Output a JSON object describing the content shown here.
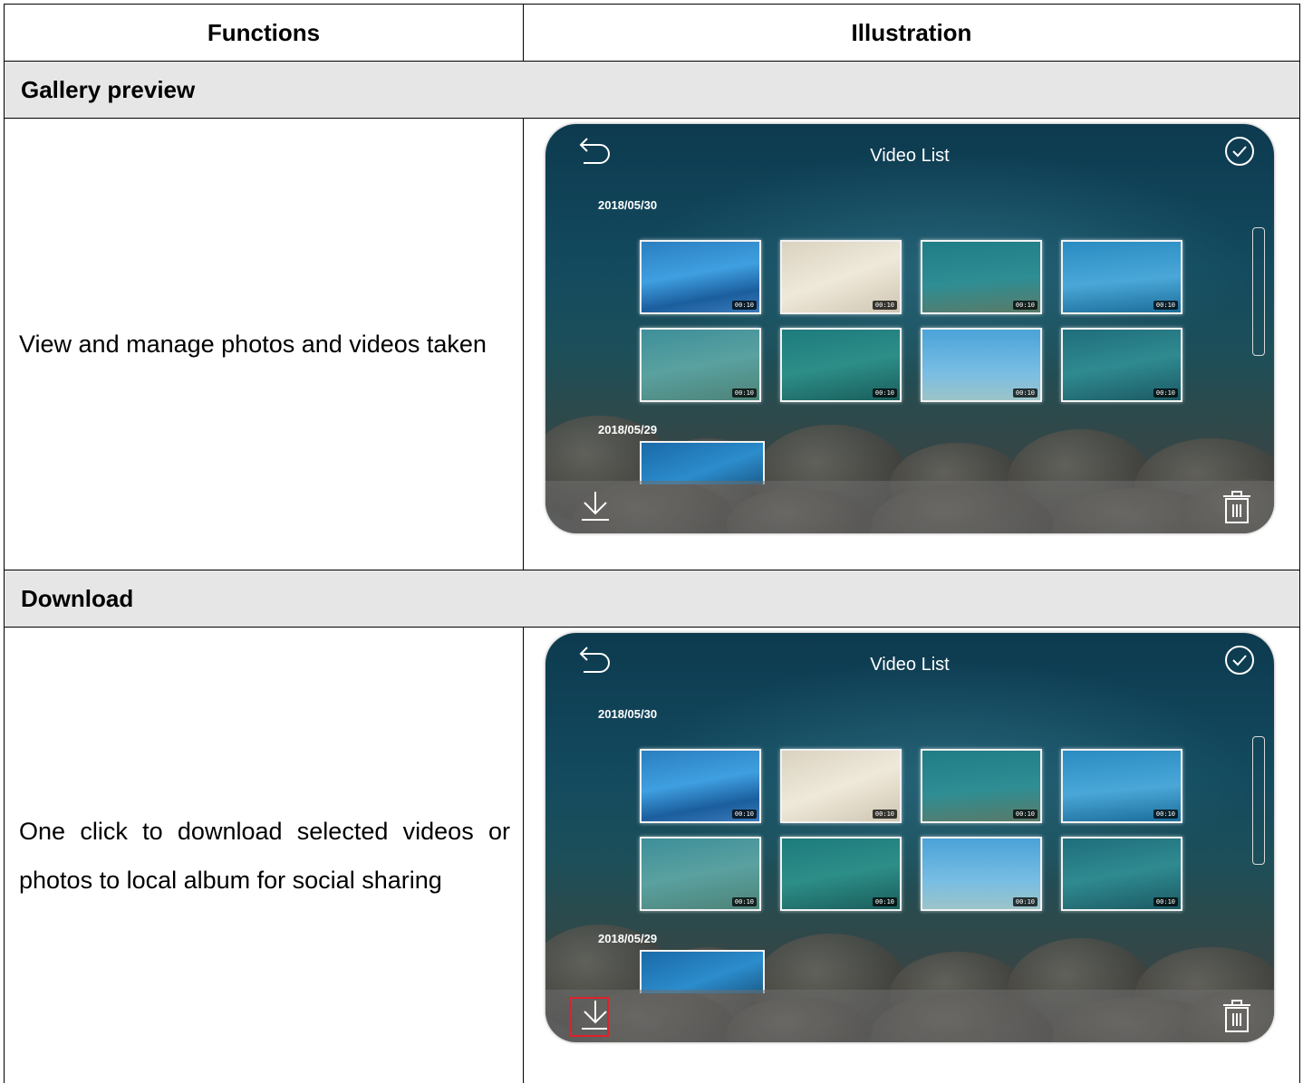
{
  "table": {
    "headers": {
      "functions": "Functions",
      "illustration": "Illustration"
    },
    "sections": [
      {
        "title": "Gallery preview",
        "description": "View and manage photos and videos taken",
        "screen": {
          "title": "Video List",
          "dates": [
            "2018/05/30",
            "2018/05/29"
          ],
          "durations": [
            "00:10",
            "00:10",
            "00:10",
            "00:10",
            "00:10",
            "00:10",
            "00:10",
            "00:10"
          ],
          "download_highlighted": false
        }
      },
      {
        "title": "Download",
        "description": "One click to download selected videos or photos to local album for social sharing",
        "screen": {
          "title": "Video List",
          "dates": [
            "2018/05/30",
            "2018/05/29"
          ],
          "durations": [
            "00:10",
            "00:10",
            "00:10",
            "00:10",
            "00:10",
            "00:10",
            "00:10",
            "00:10"
          ],
          "download_highlighted": true
        }
      }
    ]
  },
  "icons": {
    "back": "back-arrow-icon",
    "select_all": "check-circle-icon",
    "download": "download-icon",
    "delete": "trash-icon"
  },
  "colors": {
    "section_bg": "#e6e6e6",
    "highlight": "#e0202a"
  }
}
